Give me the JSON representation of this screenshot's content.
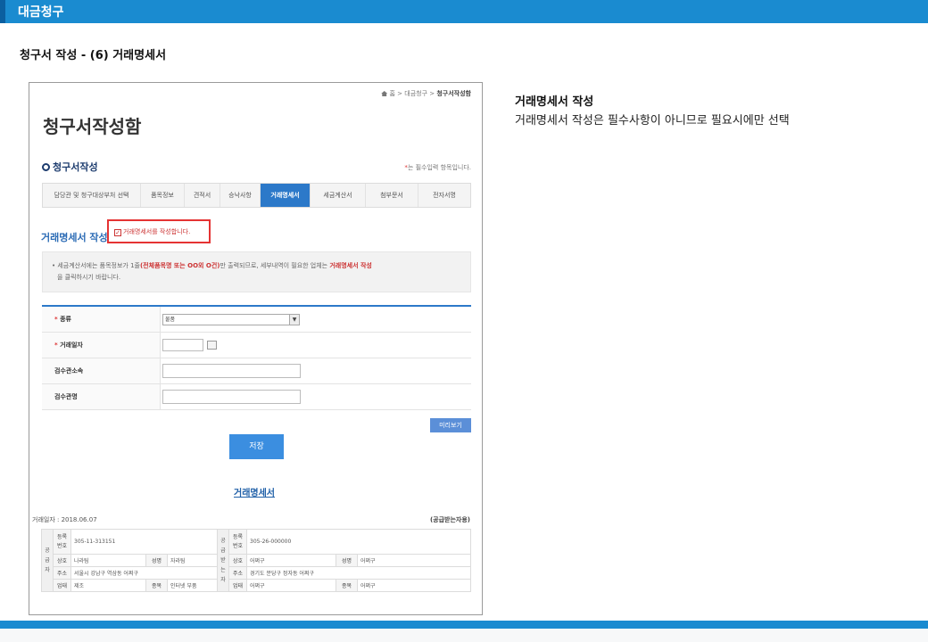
{
  "header": {
    "title": "대금청구"
  },
  "section_title": "청구서 작성 - (6) 거래명세서",
  "screenshot": {
    "breadcrumb": {
      "home": "홈",
      "sep1": ">",
      "level1": "대금청구",
      "sep2": ">",
      "current": "청구서작성함"
    },
    "page_title": "청구서작성함",
    "subsection": "청구서작성",
    "required_note": {
      "star": "*",
      "text": "는 필수입력 항목입니다."
    },
    "tabs": [
      {
        "label": "담당관 및 청구대상부처 선택",
        "active": false
      },
      {
        "label": "품목정보",
        "active": false
      },
      {
        "label": "견적서",
        "active": false
      },
      {
        "label": "승낙사항",
        "active": false
      },
      {
        "label": "거래명세서",
        "active": true
      },
      {
        "label": "세금계산서",
        "active": false
      },
      {
        "label": "첨부문서",
        "active": false
      },
      {
        "label": "전자서명",
        "active": false
      }
    ],
    "statement_heading": "거래명세서 작성",
    "checkbox_label": "거래명세서를 작성합니다.",
    "checkbox_mark": "✓",
    "info": {
      "part1": "• 세금계산서에는 품목정보가 1줄",
      "bold1": "(전체품목명 또는 OO외 O건)",
      "part2": "만 출력되므로, 세부내역이 필요한 업체는 ",
      "bold2": "거래명세서 작성",
      "part3": "을 클릭하시기 바랍니다."
    },
    "form": {
      "type_label": "종류",
      "type_value": "물품",
      "trade_date_label": "거래일자",
      "inspect_dept_label": "검수관소속",
      "inspector_label": "검수관명"
    },
    "preview_button": "미리보기",
    "save_button": "저장",
    "statement_title": "거래명세서",
    "trade_date_text": "거래일자 : 2018.06.07",
    "receiver_text": "(공급받는자용)",
    "supplier": {
      "side": "공급자",
      "reg_label": "등록번호",
      "reg": "305-11-313151",
      "name_label": "상호",
      "name": "나라팀",
      "rep_label": "성명",
      "rep": "자라팀",
      "addr_label": "주소",
      "addr": "서울시 강남구 역삼동 어쩌구",
      "biz_label": "업태",
      "biz": "제조",
      "item_label": "종목",
      "item": "인터넷 부품"
    },
    "receiver": {
      "side": "공급받는자",
      "reg_label": "등록번호",
      "reg": "305-26-000000",
      "name_label": "상호",
      "name": "어쩌구",
      "rep_label": "성명",
      "rep": "어쩌구",
      "addr_label": "주소",
      "addr": "경기도 분당구 정자동 어쩌구",
      "biz_label": "업태",
      "biz": "어쩌구",
      "item_label": "종목",
      "item": "어쩌구"
    }
  },
  "description": {
    "title": "거래명세서 작성",
    "body": "거래명세서 작성은 필수사항이 아니므로 필요시에만 선택"
  },
  "colors": {
    "header_bar": "#1a8bd0",
    "active_tab": "#2c79c9",
    "highlight_box": "#e53333"
  }
}
